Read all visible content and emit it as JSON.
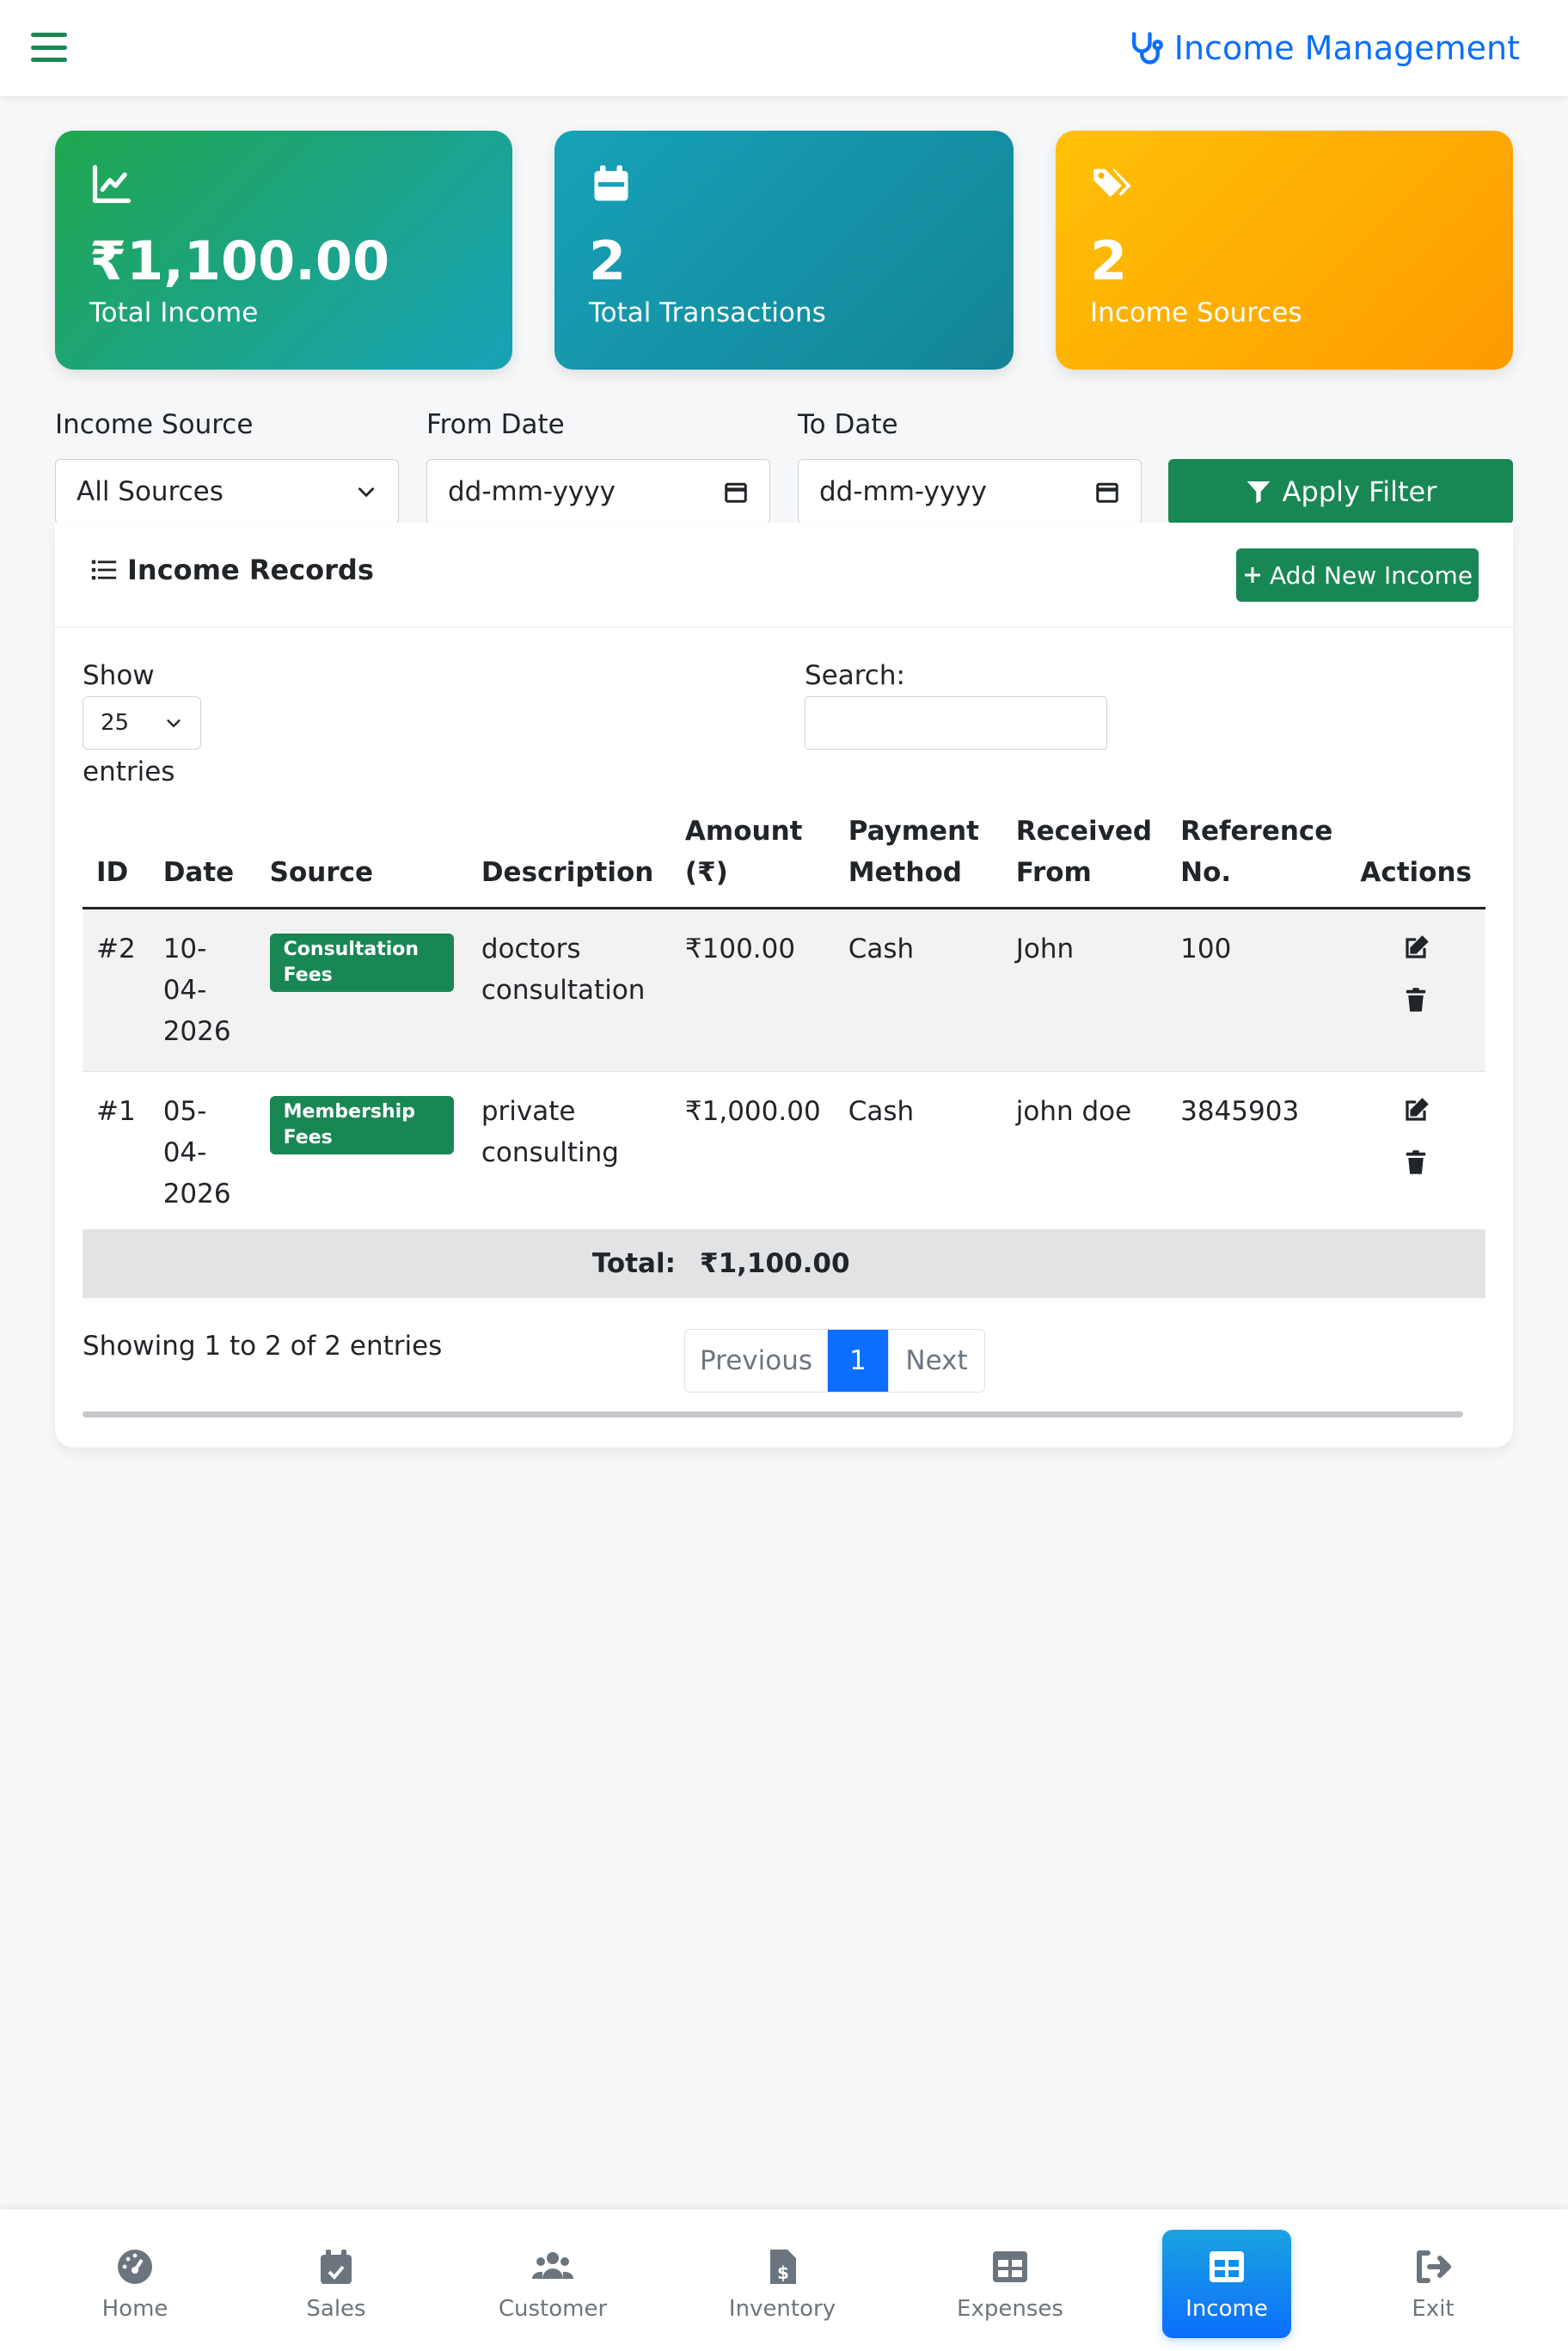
{
  "header": {
    "title": "Income Management"
  },
  "stats": [
    {
      "value": "₹1,100.00",
      "label": "Total Income"
    },
    {
      "value": "2",
      "label": "Total Transactions"
    },
    {
      "value": "2",
      "label": "Income Sources"
    }
  ],
  "filters": {
    "source_label": "Income Source",
    "source_value": "All Sources",
    "from_label": "From Date",
    "from_placeholder": "dd-mm-yyyy",
    "to_label": "To Date",
    "to_placeholder": "dd-mm-yyyy",
    "apply_label": "Apply Filter"
  },
  "records": {
    "title": "Income Records",
    "add_label": "Add New Income",
    "show_label": "Show",
    "page_size": "25",
    "entries_label": "entries",
    "search_label": "Search:",
    "columns": [
      "ID",
      "Date",
      "Source",
      "Description",
      "Amount (₹)",
      "Payment Method",
      "Received From",
      "Reference No.",
      "Actions"
    ],
    "rows": [
      {
        "id": "#2",
        "date": "10-04-2026",
        "source": "Consultation Fees",
        "description": "doctors consultation",
        "amount": "₹100.00",
        "method": "Cash",
        "from": "John",
        "ref": "100"
      },
      {
        "id": "#1",
        "date": "05-04-2026",
        "source": "Membership Fees",
        "description": "private consulting",
        "amount": "₹1,000.00",
        "method": "Cash",
        "from": "john doe",
        "ref": "3845903"
      }
    ],
    "total_label": "Total:",
    "total_value": "₹1,100.00",
    "showing": "Showing 1 to 2 of 2 entries",
    "prev": "Previous",
    "page": "1",
    "next": "Next"
  },
  "bottom_nav": [
    {
      "label": "Home",
      "icon": "dashboard-icon"
    },
    {
      "label": "Sales",
      "icon": "calendar-check-icon"
    },
    {
      "label": "Customer",
      "icon": "users-icon"
    },
    {
      "label": "Inventory",
      "icon": "invoice-dollar-icon"
    },
    {
      "label": "Expenses",
      "icon": "table-icon"
    },
    {
      "label": "Income",
      "icon": "table-icon",
      "active": true
    },
    {
      "label": "Exit",
      "icon": "sign-out-icon"
    }
  ],
  "colors": {
    "primary": "#0d6efd",
    "success": "#198754",
    "warning": "#ffc107",
    "info": "#17a2b8"
  }
}
